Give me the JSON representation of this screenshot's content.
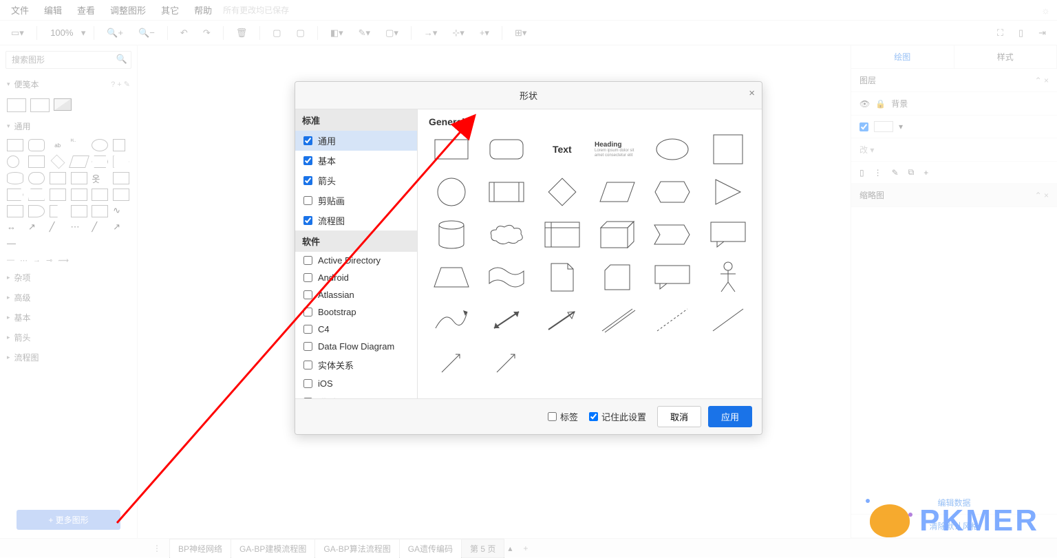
{
  "menu": {
    "file": "文件",
    "edit": "编辑",
    "view": "查看",
    "adjust": "调整图形",
    "other": "其它",
    "help": "帮助",
    "saved": "所有更改均已保存"
  },
  "toolbar": {
    "zoom": "100%"
  },
  "sidebar": {
    "search_placeholder": "搜索图形",
    "scratch": "便笺本",
    "scratch_help": "? + ✎",
    "general": "通用",
    "groups": [
      "杂项",
      "高级",
      "基本",
      "箭头",
      "流程图"
    ],
    "more": "+ 更多图形"
  },
  "right": {
    "tab_draw": "绘图",
    "tab_style": "样式",
    "layer": "图层",
    "background": "背景",
    "outline": "缩略图",
    "edit_data": "编辑数据",
    "clear_style": "清除默认风格"
  },
  "pages": {
    "tabs": [
      "BP神经网络",
      "GA-BP建模流程图",
      "GA-BP算法流程图",
      "GA遗传编码",
      "第 5 页"
    ]
  },
  "dialog": {
    "title": "形状",
    "cat_standard": "标准",
    "cat_software": "软件",
    "items_standard": [
      {
        "label": "通用",
        "checked": true,
        "sel": true
      },
      {
        "label": "基本",
        "checked": true
      },
      {
        "label": "箭头",
        "checked": true
      },
      {
        "label": "剪贴画",
        "checked": false
      },
      {
        "label": "流程图",
        "checked": true
      }
    ],
    "items_software": [
      {
        "label": "Active Directory",
        "checked": false
      },
      {
        "label": "Android",
        "checked": false
      },
      {
        "label": "Atlassian",
        "checked": false
      },
      {
        "label": "Bootstrap",
        "checked": false
      },
      {
        "label": "C4",
        "checked": false
      },
      {
        "label": "Data Flow Diagram",
        "checked": false
      },
      {
        "label": "实体关系",
        "checked": false
      },
      {
        "label": "iOS",
        "checked": false
      },
      {
        "label": "模型图",
        "checked": false
      }
    ],
    "preview_title": "General",
    "preview_text": "Text",
    "preview_heading": "Heading",
    "tags": "标签",
    "remember": "记住此设置",
    "cancel": "取消",
    "apply": "应用"
  },
  "watermark": "PKMER"
}
